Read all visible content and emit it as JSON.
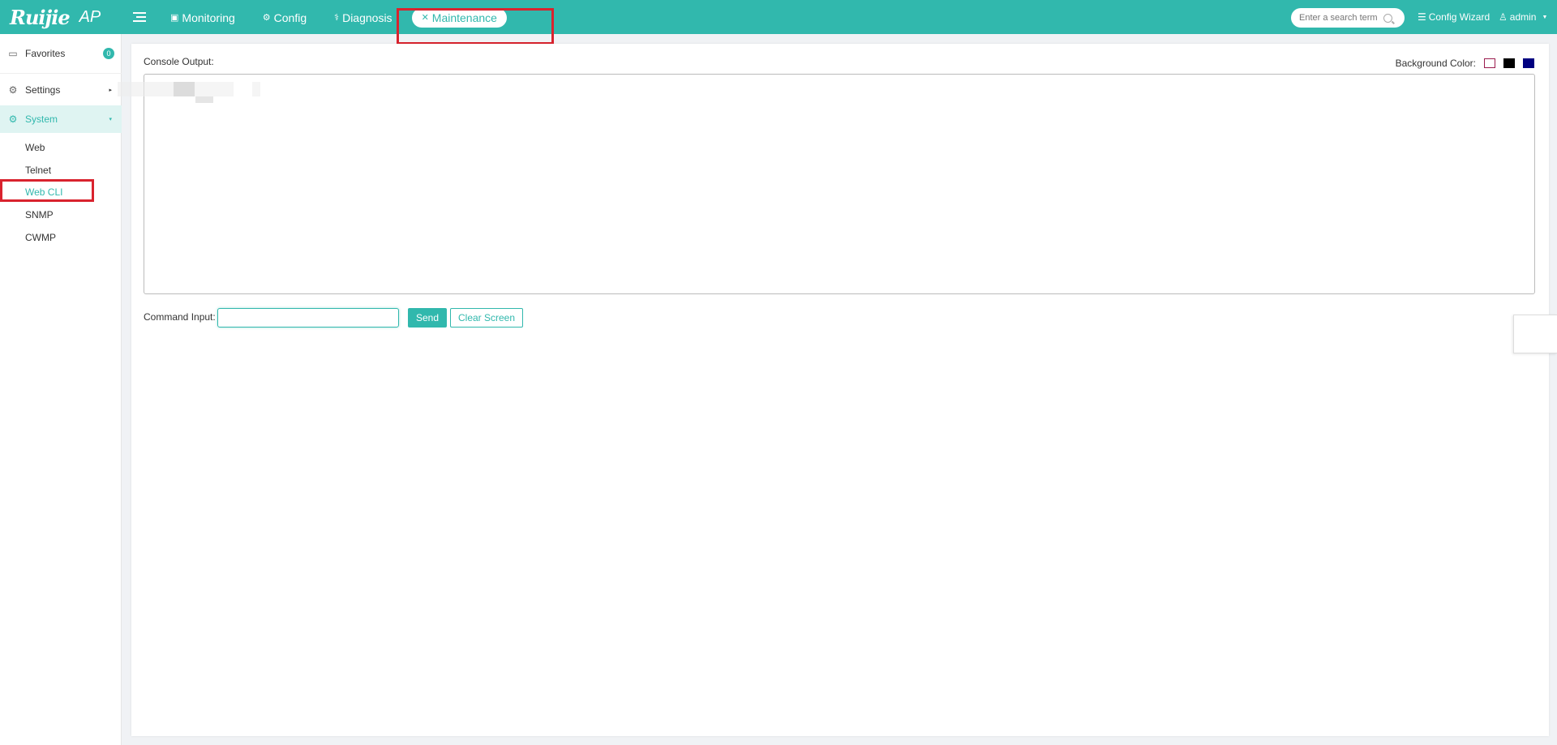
{
  "app": {
    "brand": "Ruijie",
    "model": "AP"
  },
  "nav": {
    "items": [
      {
        "label": "Monitoring",
        "icon": "monitor-icon"
      },
      {
        "label": "Config",
        "icon": "gear-icon"
      },
      {
        "label": "Diagnosis",
        "icon": "stethoscope-icon"
      },
      {
        "label": "Maintenance",
        "icon": "tools-icon",
        "active": true
      }
    ]
  },
  "search": {
    "placeholder": "Enter a search term"
  },
  "header_right": {
    "config_wizard": "Config Wizard",
    "user": "admin"
  },
  "sidebar": {
    "favorites": {
      "label": "Favorites",
      "count": "0"
    },
    "settings": {
      "label": "Settings"
    },
    "system": {
      "label": "System",
      "expanded": true
    },
    "sub_items": [
      "Web",
      "Telnet",
      "Web CLI",
      "SNMP",
      "CWMP"
    ],
    "active_sub_item": "Web CLI"
  },
  "console": {
    "output_label": "Console Output:",
    "background_label": "Background Color:",
    "background_options": [
      "#ffffff",
      "#000000",
      "#000080"
    ],
    "command_label": "Command Input:",
    "command_value": "",
    "send_label": "Send",
    "clear_label": "Clear Screen"
  },
  "colors": {
    "accent": "#31b8ad",
    "highlight": "#d9232e"
  }
}
